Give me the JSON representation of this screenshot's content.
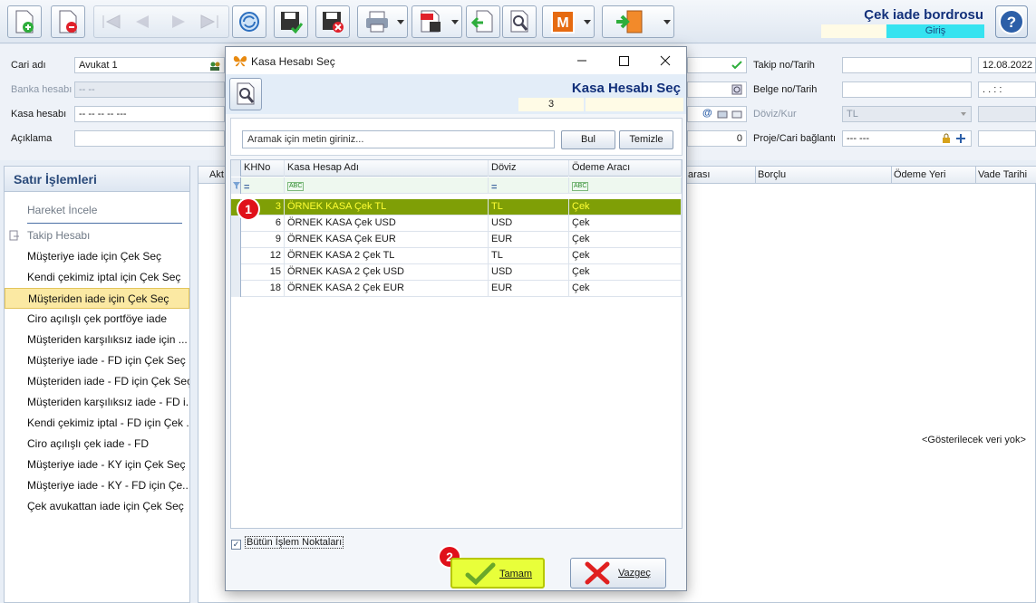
{
  "document": {
    "title": "Çek iade bordrosu",
    "mode": "Giriş"
  },
  "form": {
    "cari_label": "Cari adı",
    "cari_value": "Avukat 1",
    "banka_label": "Banka hesabı",
    "banka_value": "-- --",
    "kasa_label": "Kasa hesabı",
    "kasa_value": "-- -- -- -- ---",
    "aciklama_label": "Açıklama",
    "amount_value": "0",
    "takip_label": "Takip no/Tarih",
    "takip_date": "12.08.2022",
    "belge_label": "Belge no/Tarih",
    "belge_date": ". .    : :",
    "doviz_label": "Döviz/Kur",
    "doviz_value": "TL",
    "proje_label": "Proje/Cari bağlantı",
    "proje_value": "--- ---"
  },
  "left_panel": {
    "title": "Satır İşlemleri",
    "top_items": [
      "Hareket İncele",
      "Takip Hesabı"
    ],
    "items": [
      "Müşteriye iade için Çek Seç",
      "Kendi çekimiz iptal için Çek Seç",
      "Müşteriden iade için Çek Seç",
      "Ciro açılışlı çek portföye iade",
      "Müşteriden karşılıksız iade için ...",
      "Müşteriye iade - FD için Çek Seç",
      "Müşteriden iade - FD için Çek Seç",
      "Müşteriden karşılıksız iade - FD i...",
      "Kendi çekimiz iptal - FD için Çek ...",
      "Ciro açılışlı çek iade - FD",
      "Müşteriye iade - KY için Çek Seç",
      "Müşteriye iade - KY - FD için Çe...",
      "Çek avukattan iade için Çek Seç"
    ],
    "selected_index": 2
  },
  "main_grid": {
    "columns": [
      "Akt",
      "arası",
      "Borçlu",
      "Ödeme Yeri",
      "Vade Tarihi"
    ],
    "empty_text": "<Gösterilecek veri yok>"
  },
  "dialog": {
    "window_title": "Kasa Hesabı Seç",
    "header_title": "Kasa Hesabı Seç",
    "header_code": "3",
    "search_placeholder": "Aramak için metin giriniz...",
    "find_label": "Bul",
    "clear_label": "Temizle",
    "columns": [
      "KHNo",
      "Kasa Hesap Adı",
      "Döviz",
      "Ödeme Aracı"
    ],
    "rows": [
      {
        "no": "3",
        "name": "ÖRNEK KASA Çek TL",
        "doviz": "TL",
        "arac": "Çek"
      },
      {
        "no": "6",
        "name": "ÖRNEK KASA Çek USD",
        "doviz": "USD",
        "arac": "Çek"
      },
      {
        "no": "9",
        "name": "ÖRNEK KASA Çek EUR",
        "doviz": "EUR",
        "arac": "Çek"
      },
      {
        "no": "12",
        "name": "ÖRNEK KASA 2 Çek TL",
        "doviz": "TL",
        "arac": "Çek"
      },
      {
        "no": "15",
        "name": "ÖRNEK KASA 2 Çek USD",
        "doviz": "USD",
        "arac": "Çek"
      },
      {
        "no": "18",
        "name": "ÖRNEK KASA 2 Çek EUR",
        "doviz": "EUR",
        "arac": "Çek"
      }
    ],
    "selected_row": 0,
    "checkbox_label": "Bütün İşlem Noktaları",
    "ok_label": "Tamam",
    "cancel_label": "Vazgeç",
    "badge_1": "1",
    "badge_2": "2"
  },
  "colors": {
    "accent": "#12307a",
    "selection": "#7f9f06",
    "mode_bg": "#36e3f0",
    "badge": "#e0101a"
  }
}
